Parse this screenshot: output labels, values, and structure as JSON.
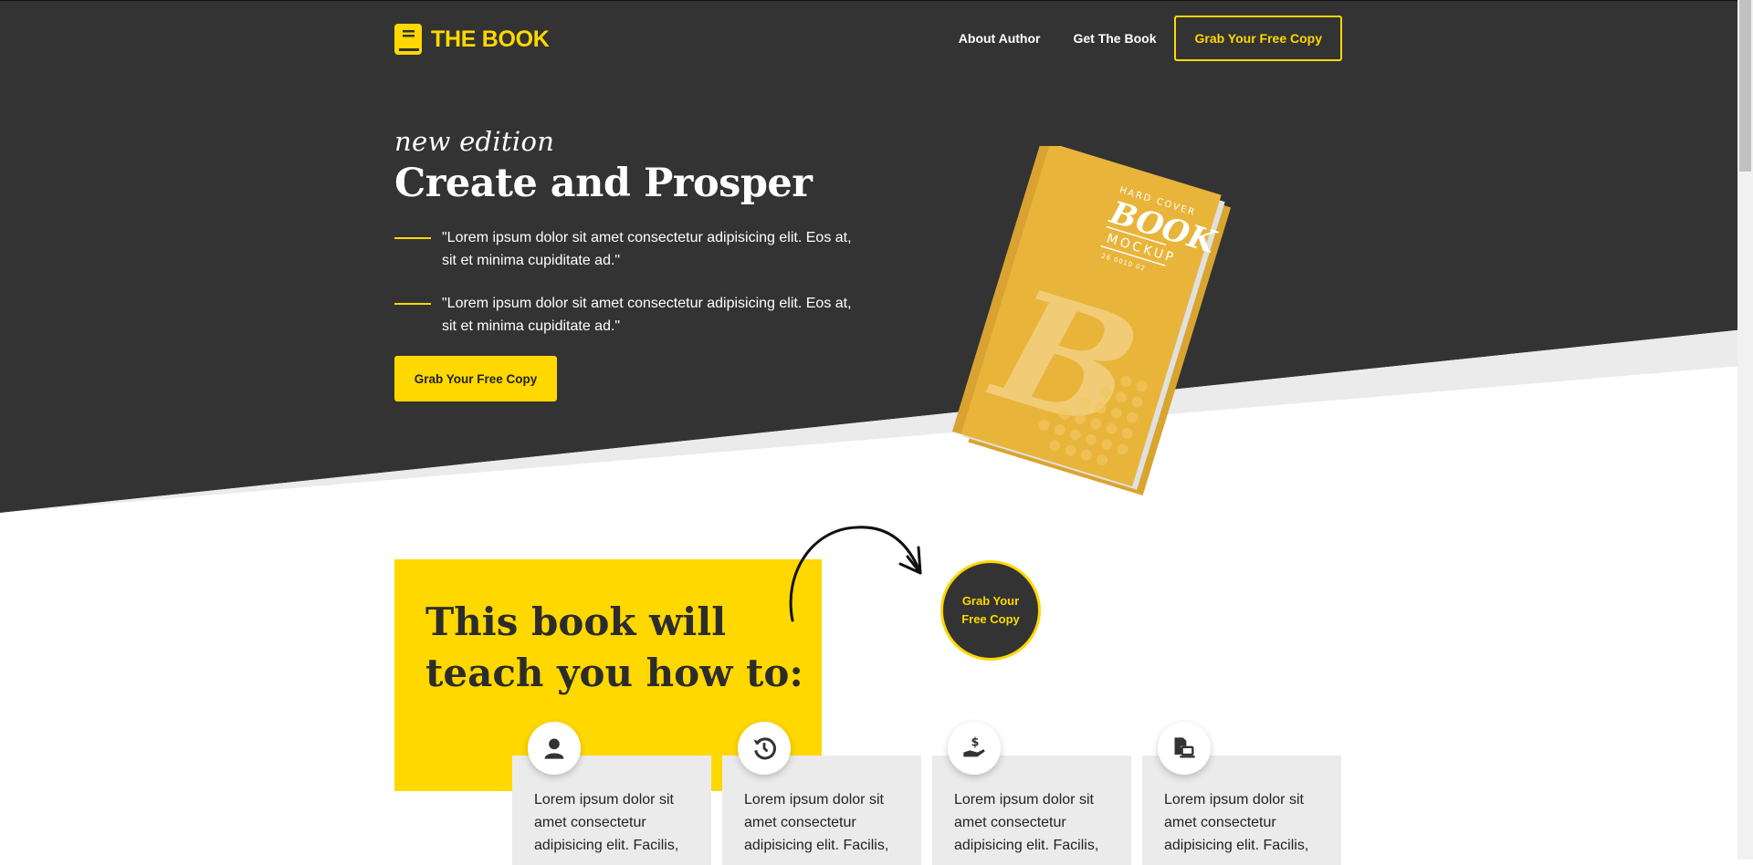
{
  "brand": {
    "name": "THE BOOK",
    "accent": "#FFD800",
    "dark": "#333333"
  },
  "nav": {
    "links": [
      "About Author",
      "Get The Book"
    ],
    "cta": "Grab Your Free Copy"
  },
  "hero": {
    "eyebrow": "new edition",
    "title": "Create and Prosper",
    "quotes": [
      "\"Lorem ipsum dolor sit amet consectetur adipisicing elit. Eos at, sit et minima cupiditate ad.\"",
      "\"Lorem ipsum dolor sit amet consectetur adipisicing elit. Eos at, sit et minima cupiditate ad.\""
    ],
    "button": "Grab Your Free Copy"
  },
  "book_mockup": {
    "line1": "HARD COVER",
    "line2": "BOOK",
    "line3": "MOCKUP",
    "line4": "26 0010 02",
    "letter": "B"
  },
  "teach": {
    "title": "This book will teach you how to:",
    "circle_button": "Grab Your Free Copy"
  },
  "cards": [
    {
      "icon": "user-icon",
      "text": "Lorem ipsum dolor sit amet consectetur adipisicing elit. Facilis,"
    },
    {
      "icon": "history-icon",
      "text": "Lorem ipsum dolor sit amet consectetur adipisicing elit. Facilis,"
    },
    {
      "icon": "hand-dollar-icon",
      "text": "Lorem ipsum dolor sit amet consectetur adipisicing elit. Facilis,"
    },
    {
      "icon": "file-laptop-icon",
      "text": "Lorem ipsum dolor sit amet consectetur adipisicing elit. Facilis,"
    }
  ]
}
